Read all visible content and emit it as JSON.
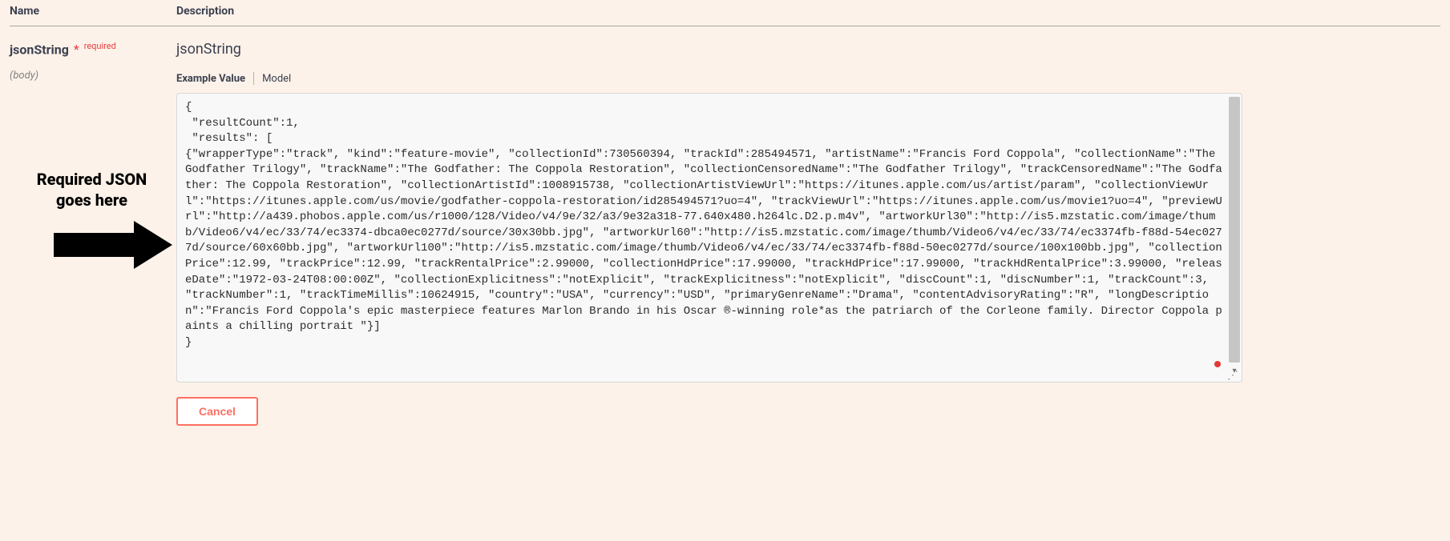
{
  "headers": {
    "name": "Name",
    "description": "Description"
  },
  "param": {
    "name": "jsonString",
    "required_star": "*",
    "required_label": "required",
    "in": "(body)",
    "desc_title": "jsonString"
  },
  "tabs": {
    "example_value": "Example Value",
    "model": "Model"
  },
  "body_text": "{\n \"resultCount\":1,\n \"results\": [\n{\"wrapperType\":\"track\", \"kind\":\"feature-movie\", \"collectionId\":730560394, \"trackId\":285494571, \"artistName\":\"Francis Ford Coppola\", \"collectionName\":\"The Godfather Trilogy\", \"trackName\":\"The Godfather: The Coppola Restoration\", \"collectionCensoredName\":\"The Godfather Trilogy\", \"trackCensoredName\":\"The Godfather: The Coppola Restoration\", \"collectionArtistId\":1008915738, \"collectionArtistViewUrl\":\"https://itunes.apple.com/us/artist/param\", \"collectionViewUrl\":\"https://itunes.apple.com/us/movie/godfather-coppola-restoration/id285494571?uo=4\", \"trackViewUrl\":\"https://itunes.apple.com/us/movie1?uo=4\", \"previewUrl\":\"http://a439.phobos.apple.com/us/r1000/128/Video/v4/9e/32/a3/9e32a318-77.640x480.h264lc.D2.p.m4v\", \"artworkUrl30\":\"http://is5.mzstatic.com/image/thumb/Video6/v4/ec/33/74/ec3374-dbca0ec0277d/source/30x30bb.jpg\", \"artworkUrl60\":\"http://is5.mzstatic.com/image/thumb/Video6/v4/ec/33/74/ec3374fb-f88d-54ec0277d/source/60x60bb.jpg\", \"artworkUrl100\":\"http://is5.mzstatic.com/image/thumb/Video6/v4/ec/33/74/ec3374fb-f88d-50ec0277d/source/100x100bb.jpg\", \"collectionPrice\":12.99, \"trackPrice\":12.99, \"trackRentalPrice\":2.99000, \"collectionHdPrice\":17.99000, \"trackHdPrice\":17.99000, \"trackHdRentalPrice\":3.99000, \"releaseDate\":\"1972-03-24T08:00:00Z\", \"collectionExplicitness\":\"notExplicit\", \"trackExplicitness\":\"notExplicit\", \"discCount\":1, \"discNumber\":1, \"trackCount\":3, \"trackNumber\":1, \"trackTimeMillis\":10624915, \"country\":\"USA\", \"currency\":\"USD\", \"primaryGenreName\":\"Drama\", \"contentAdvisoryRating\":\"R\", \"longDescription\":\"Francis Ford Coppola's epic masterpiece features Marlon Brando in his Oscar ®-winning role*as the patriarch of the Corleone family. Director Coppola paints a chilling portrait \"}]\n}",
  "buttons": {
    "cancel": "Cancel"
  },
  "annotation": {
    "line1": "Required JSON",
    "line2": "goes here"
  }
}
